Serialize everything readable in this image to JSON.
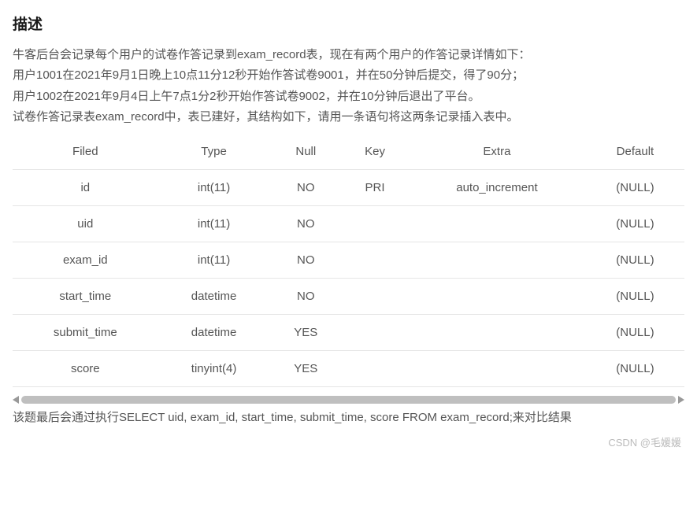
{
  "title": "描述",
  "paragraphs": [
    "牛客后台会记录每个用户的试卷作答记录到exam_record表，现在有两个用户的作答记录详情如下：",
    "用户1001在2021年9月1日晚上10点11分12秒开始作答试卷9001，并在50分钟后提交，得了90分；",
    "用户1002在2021年9月4日上午7点1分2秒开始作答试卷9002，并在10分钟后退出了平台。",
    "试卷作答记录表exam_record中，表已建好，其结构如下，请用一条语句将这两条记录插入表中。"
  ],
  "table": {
    "headers": [
      "Filed",
      "Type",
      "Null",
      "Key",
      "Extra",
      "Default"
    ],
    "rows": [
      [
        "id",
        "int(11)",
        "NO",
        "PRI",
        "auto_increment",
        "(NULL)"
      ],
      [
        "uid",
        "int(11)",
        "NO",
        "",
        "",
        "(NULL)"
      ],
      [
        "exam_id",
        "int(11)",
        "NO",
        "",
        "",
        "(NULL)"
      ],
      [
        "start_time",
        "datetime",
        "NO",
        "",
        "",
        "(NULL)"
      ],
      [
        "submit_time",
        "datetime",
        "YES",
        "",
        "",
        "(NULL)"
      ],
      [
        "score",
        "tinyint(4)",
        "YES",
        "",
        "",
        "(NULL)"
      ]
    ]
  },
  "after_text": "该题最后会通过执行SELECT uid, exam_id, start_time, submit_time, score FROM exam_record;来对比结果",
  "watermark": "CSDN @毛媛媛"
}
